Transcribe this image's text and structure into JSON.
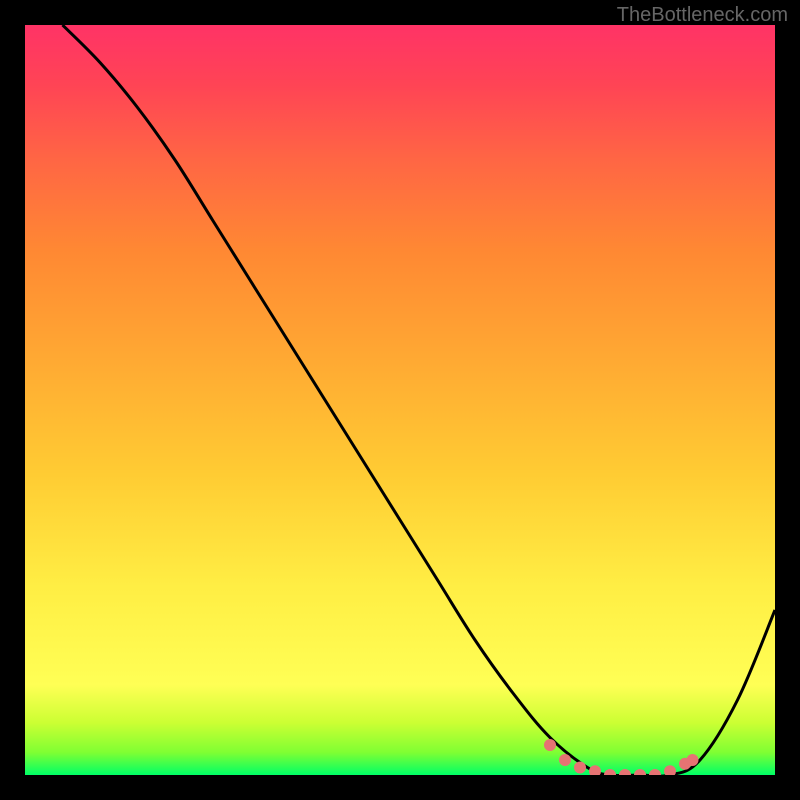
{
  "watermark": "TheBottleneck.com",
  "chart_data": {
    "type": "line",
    "title": "",
    "xlabel": "",
    "ylabel": "",
    "xlim": [
      0,
      100
    ],
    "ylim": [
      0,
      100
    ],
    "gradient_stops": [
      {
        "offset": 0,
        "color": "#00ff66"
      },
      {
        "offset": 3,
        "color": "#7fff33"
      },
      {
        "offset": 7,
        "color": "#ccff33"
      },
      {
        "offset": 12,
        "color": "#ffff55"
      },
      {
        "offset": 25,
        "color": "#ffee44"
      },
      {
        "offset": 40,
        "color": "#ffcc33"
      },
      {
        "offset": 55,
        "color": "#ffaa33"
      },
      {
        "offset": 70,
        "color": "#ff8833"
      },
      {
        "offset": 82,
        "color": "#ff6644"
      },
      {
        "offset": 92,
        "color": "#ff4455"
      },
      {
        "offset": 100,
        "color": "#ff3366"
      }
    ],
    "series": [
      {
        "name": "bottleneck-curve",
        "x": [
          5,
          10,
          15,
          20,
          25,
          30,
          35,
          40,
          45,
          50,
          55,
          60,
          65,
          70,
          75,
          78,
          82,
          86,
          90,
          95,
          100
        ],
        "y": [
          100,
          95,
          89,
          82,
          74,
          66,
          58,
          50,
          42,
          34,
          26,
          18,
          11,
          5,
          1,
          0,
          0,
          0,
          2,
          10,
          22
        ]
      }
    ],
    "markers": {
      "name": "optimal-range",
      "color": "#e67373",
      "points": [
        {
          "x": 70,
          "y": 4
        },
        {
          "x": 72,
          "y": 2
        },
        {
          "x": 74,
          "y": 1
        },
        {
          "x": 76,
          "y": 0.5
        },
        {
          "x": 78,
          "y": 0
        },
        {
          "x": 80,
          "y": 0
        },
        {
          "x": 82,
          "y": 0
        },
        {
          "x": 84,
          "y": 0
        },
        {
          "x": 86,
          "y": 0.5
        },
        {
          "x": 88,
          "y": 1.5
        },
        {
          "x": 89,
          "y": 2
        }
      ]
    }
  }
}
